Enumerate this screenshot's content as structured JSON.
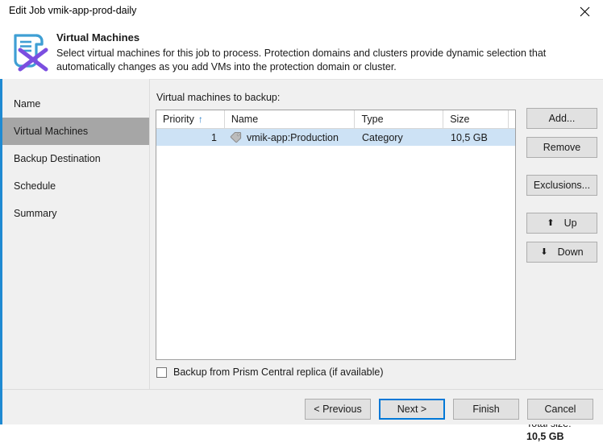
{
  "window": {
    "title": "Edit Job vmik-app-prod-daily",
    "close_icon": "close-icon"
  },
  "header": {
    "icon": "virtual-machines-document-x-icon",
    "title": "Virtual Machines",
    "description": "Select virtual machines for this job to process. Protection domains and clusters provide dynamic selection that automatically changes as you add VMs into the protection domain or cluster."
  },
  "sidebar": {
    "items": [
      {
        "label": "Name",
        "active": false
      },
      {
        "label": "Virtual Machines",
        "active": true
      },
      {
        "label": "Backup Destination",
        "active": false
      },
      {
        "label": "Schedule",
        "active": false
      },
      {
        "label": "Summary",
        "active": false
      }
    ]
  },
  "main": {
    "list_label": "Virtual machines to backup:",
    "table": {
      "columns": [
        "Priority",
        "Name",
        "Type",
        "Size"
      ],
      "sort_column": "Priority",
      "sort_arrow": "↑",
      "rows": [
        {
          "priority": "1",
          "icon": "tag-icon",
          "name": "vmik-app:Production",
          "type": "Category",
          "size": "10,5 GB",
          "selected": true
        }
      ]
    },
    "side_buttons": [
      {
        "label": "Add...",
        "icon": null
      },
      {
        "label": "Remove",
        "icon": null
      },
      {
        "label": "Exclusions...",
        "icon": null
      },
      {
        "label": "Up",
        "icon": "arrow-up-icon",
        "glyph": "⬆"
      },
      {
        "label": "Down",
        "icon": "arrow-down-icon",
        "glyph": "⬇"
      }
    ],
    "total_size": {
      "label": "Total size:",
      "value": "10,5 GB"
    },
    "checkbox": {
      "label": "Backup from Prism Central replica (if available)",
      "checked": false
    }
  },
  "footer": {
    "buttons": [
      {
        "label": "< Previous",
        "primary": false
      },
      {
        "label": "Next >",
        "primary": true
      },
      {
        "label": "Finish",
        "primary": false
      },
      {
        "label": "Cancel",
        "primary": false
      }
    ]
  },
  "colors": {
    "accent_blue": "#1f8ad2",
    "focus_blue": "#0078d7",
    "selection_blue": "#cde2f5",
    "nav_active_gray": "#a6a6a6",
    "body_gray": "#f0f0f0",
    "sort_arrow_blue": "#2a7fc9"
  }
}
